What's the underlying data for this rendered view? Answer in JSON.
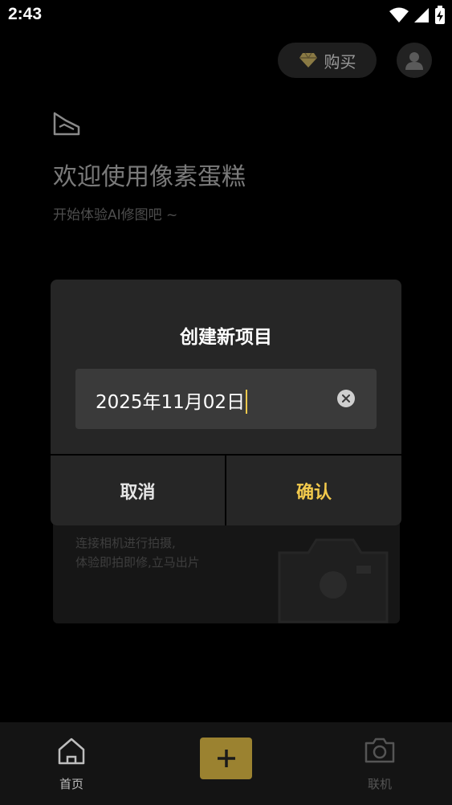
{
  "status_bar": {
    "time": "2:43"
  },
  "header": {
    "buy_label": "购买"
  },
  "welcome": {
    "title": "欢迎使用像素蛋糕",
    "subtitle": "开始体验AI修图吧 ~"
  },
  "camera_card": {
    "line1": "连接相机进行拍摄,",
    "line2": "体验即拍即修,立马出片"
  },
  "dialog": {
    "title": "创建新项目",
    "input_value": "2025年11月02日",
    "cancel_label": "取消",
    "confirm_label": "确认"
  },
  "bottom_nav": {
    "home_label": "首页",
    "add_symbol": "+",
    "connect_label": "联机"
  },
  "colors": {
    "accent": "#f2c94c",
    "add_button": "#9b8230",
    "dialog_bg": "#262626",
    "background": "#000000"
  }
}
